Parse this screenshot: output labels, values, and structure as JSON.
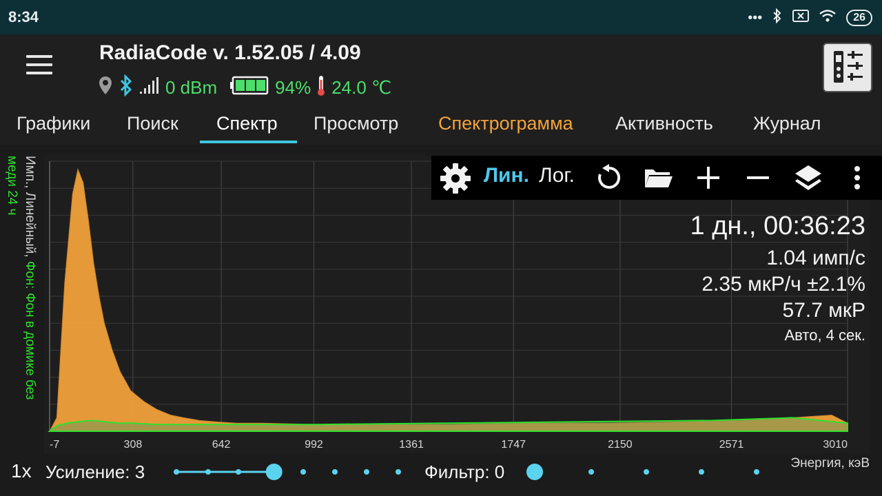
{
  "status": {
    "time": "8:34",
    "battery_level": "26"
  },
  "header": {
    "title": "RadiaCode v. 1.52.05 / 4.09",
    "signal": "0 dBm",
    "battery": "94%",
    "temperature": "24.0 ℃"
  },
  "tabs": [
    {
      "label": "Графики"
    },
    {
      "label": "Поиск"
    },
    {
      "label": "Спектр"
    },
    {
      "label": "Просмотр"
    },
    {
      "label": "Спектрограмма"
    },
    {
      "label": "Активность"
    },
    {
      "label": "Журнал"
    }
  ],
  "toolbar": {
    "lin_label": "Лин.",
    "log_label": "Лог."
  },
  "stats": {
    "duration": "1 дн., 00:36:23",
    "rate": "1.04 имп/с",
    "dose_rate": "2.35 мкР/ч ±2.1%",
    "dose": "57.7 мкР",
    "mode": "Авто, 4 сек."
  },
  "y_axis": {
    "label_line1": "Имп., Линейный, ",
    "label_green1": "Фон: Фон в домике без",
    "label_green2": "меди 24 ч"
  },
  "bottom": {
    "speed": "1x",
    "gain_label": "Усиление: 3",
    "filter_label": "Фильтр: 0",
    "energy_label": "Энергия, кэВ",
    "gain_fraction": 0.44,
    "filter_fraction": 0
  },
  "chart_data": {
    "type": "area",
    "xlabel": "Энергия, кэВ",
    "ylabel": "Имп., Линейный",
    "x_ticks": [
      "-7",
      "308",
      "642",
      "992",
      "1361",
      "1747",
      "2150",
      "2571",
      "3010"
    ],
    "xlim": [
      -7,
      3010
    ],
    "ylim": [
      0,
      100
    ],
    "grid": true,
    "series": [
      {
        "name": "Имп.",
        "color": "#f0a03a",
        "x": [
          -7,
          20,
          50,
          80,
          100,
          120,
          140,
          160,
          180,
          200,
          230,
          260,
          300,
          350,
          400,
          450,
          500,
          560,
          620,
          700,
          800,
          1000,
          1200,
          1500,
          1800,
          2100,
          2400,
          2600,
          2800,
          2950,
          3010
        ],
        "y": [
          0,
          5,
          55,
          88,
          97,
          92,
          78,
          62,
          50,
          40,
          30,
          22,
          15,
          11,
          8,
          6,
          5,
          4,
          3.5,
          3,
          3,
          2.5,
          2.5,
          2.5,
          3,
          3,
          3.5,
          4,
          5,
          6,
          3
        ]
      },
      {
        "name": "Фон: Фон в домике без меди 24 ч",
        "color": "#2ee02e",
        "x": [
          -7,
          20,
          60,
          100,
          150,
          200,
          250,
          300,
          400,
          600,
          800,
          1000,
          1500,
          2000,
          2500,
          2800,
          3010
        ],
        "y": [
          0,
          2,
          3,
          3.5,
          4,
          3.5,
          3,
          3,
          2.5,
          2.5,
          2.5,
          2.5,
          3,
          3.5,
          4,
          5,
          3
        ]
      }
    ]
  }
}
